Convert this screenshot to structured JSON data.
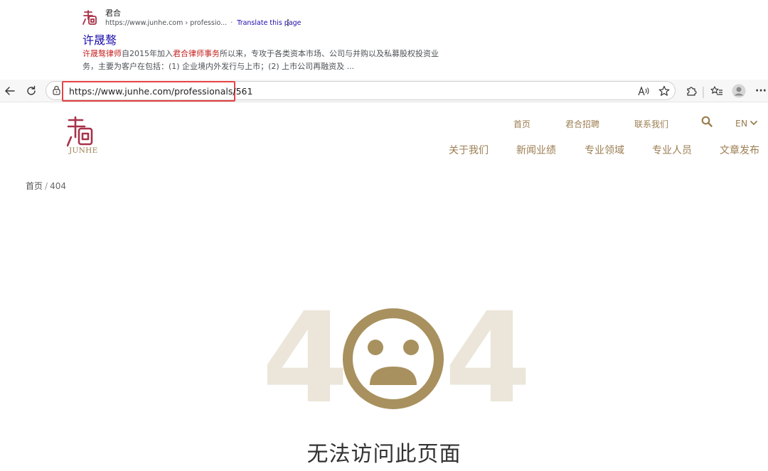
{
  "search_result": {
    "site_name": "君合",
    "url": "https://www.junhe.com › professio...",
    "translate_separator": "·",
    "translate_link": "Translate this page",
    "title": "许晟骜",
    "snippet": {
      "p1": "许晟骜律师",
      "p2": "自2015年加入",
      "p3": "君合律师事务",
      "p4": "所以来，专攻于各类资本市场、公司与并购以及私募股权投资业务，主要为客户在包括：(1) 企业境内外发行与上市；(2) 上市公司再融资及 ..."
    }
  },
  "browser": {
    "address_url": "https://www.junhe.com/professionals/561"
  },
  "site": {
    "logo_text": "JUNHE",
    "top_nav": [
      "首页",
      "君合招聘",
      "联系我们"
    ],
    "lang": "EN",
    "main_nav": [
      "关于我们",
      "新闻业绩",
      "专业领域",
      "专业人员",
      "文章发布"
    ],
    "brand_color": "#9b7e52",
    "logo_color": "#a8324a"
  },
  "breadcrumb": {
    "home": "首页",
    "separator": "/",
    "current": "404"
  },
  "error": {
    "digit_left": "4",
    "digit_right": "4",
    "face_icon": "sad-face-icon",
    "message": "无法访问此页面"
  }
}
